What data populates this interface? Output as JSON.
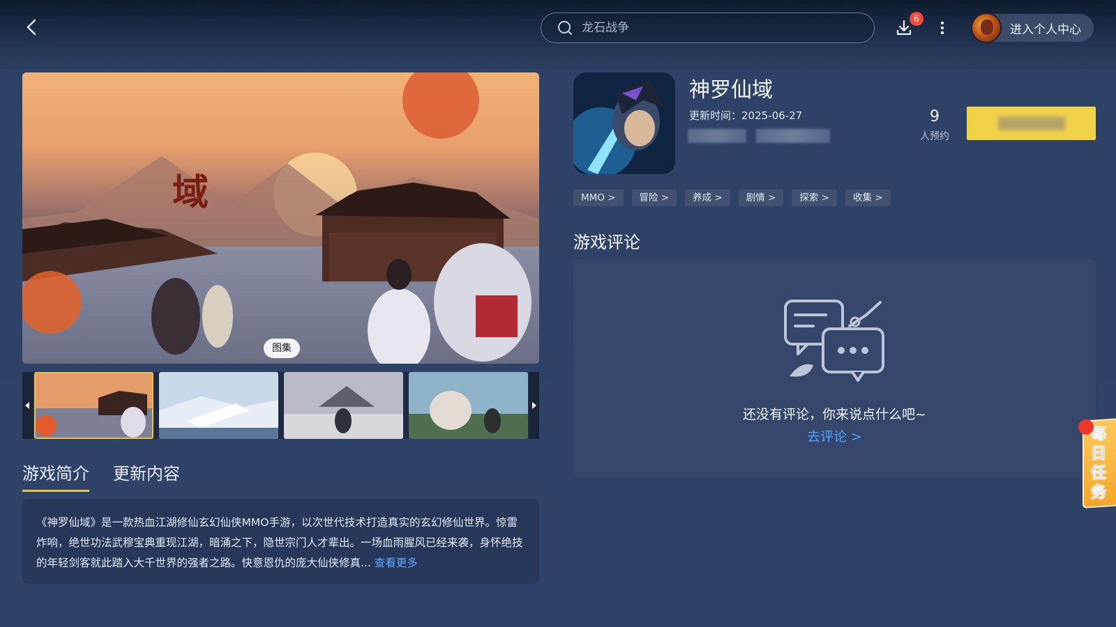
{
  "search": {
    "placeholder": "龙石战争"
  },
  "header": {
    "download_badge": "6",
    "profile_label": "进入个人中心"
  },
  "media": {
    "gallery_label": "图集"
  },
  "game": {
    "title": "神罗仙域",
    "update_time": "更新时间：2025-06-27",
    "reserve_count": "9",
    "reserve_label": "人预约",
    "tags": [
      "MMO >",
      "冒险 >",
      "养成 >",
      "剧情 >",
      "探索 >",
      "收集 >"
    ]
  },
  "tabs": [
    "游戏简介",
    "更新内容"
  ],
  "intro": {
    "text": "《神罗仙域》是一款热血江湖修仙玄幻仙侠MMO手游，以次世代技术打造真实的玄幻修仙世界。惊雷炸响，绝世功法武穆宝典重现江湖，暗涌之下，隐世宗门人才辈出。一场血雨腥风已经来袭，身怀绝技的年轻剑客就此踏入大千世界的强者之路。快意恩仇的庞大仙侠修真...",
    "more_label": "查看更多"
  },
  "reviews": {
    "title": "游戏评论",
    "empty_text": "还没有评论，你来说点什么吧~",
    "go_review": "去评论 >"
  },
  "daily_task": {
    "label": "每日任务"
  },
  "icons": {
    "back": "back-arrow-icon",
    "search": "search-icon",
    "download": "download-icon",
    "more": "more-vertical-icon",
    "thumb_prev": "caret-left-icon",
    "thumb_next": "caret-right-icon",
    "reviews_empty": "chat-bubbles-icon"
  },
  "colors": {
    "accent_yellow": "#f1d34a",
    "link_blue": "#4da3ff",
    "badge_red": "#f44a3e",
    "panel": "#35466a"
  }
}
